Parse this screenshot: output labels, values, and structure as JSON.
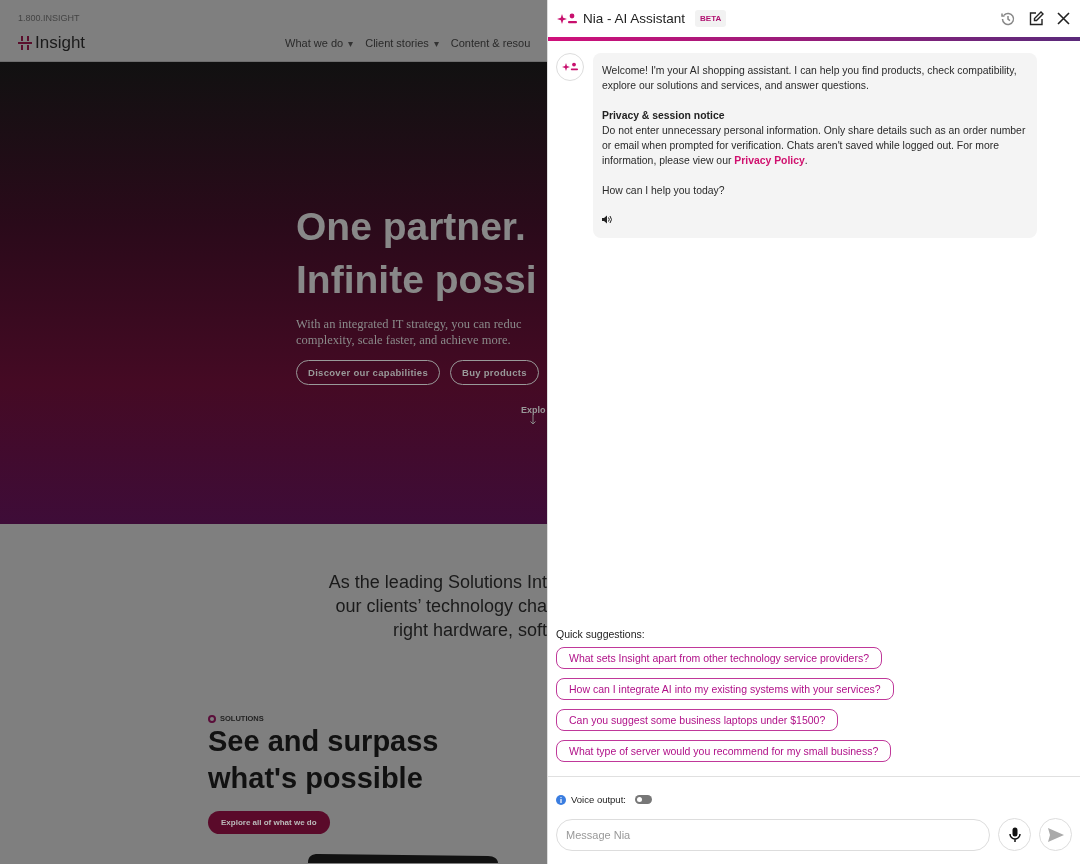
{
  "website": {
    "phone": "1.800.INSIGHT",
    "logo": "Insight",
    "nav": [
      {
        "label": "What we do",
        "caret": "▾"
      },
      {
        "label": "Client stories",
        "caret": "▾"
      },
      {
        "label": "Content & resou"
      }
    ],
    "hero": {
      "title_lines": [
        "One partner.",
        "Infinite possi"
      ],
      "text_lines": [
        "With an integrated IT strategy, you can reduc",
        "complexity, scale faster, and achieve more."
      ],
      "buttons": [
        "Discover our capabilities",
        "Buy products"
      ],
      "scroll_hint": "Explo"
    },
    "intro_lines": [
      "As the leading Solutions Int",
      "our clients’ technology cha",
      "right hardware, soft"
    ],
    "solutions": {
      "eyebrow": "SOLUTIONS",
      "title_lines": [
        "See and surpass",
        "what's possible"
      ],
      "button": "Explore all of what we do"
    }
  },
  "assistant": {
    "title": "Nia - AI Assistant",
    "badge": "BETA",
    "message": {
      "greeting": "Welcome! I'm your AI shopping assistant. I can help you find products, check compatibility, explore our solutions and services, and answer questions.",
      "notice_title": "Privacy & session notice",
      "notice_text": "Do not enter unnecessary personal information. Only share details such as an order number or email when prompted for verification. Chats aren't saved while logged out. For more information, please view our",
      "link": "Privacy Policy",
      "link_after": ".",
      "question": "How can I help you today?"
    },
    "suggestions_label": "Quick suggestions:",
    "suggestions": [
      "What sets Insight apart from other technology service providers?",
      "How can I integrate AI into my existing systems with your services?",
      "Can you suggest some business laptops under $1500?",
      "What type of server would you recommend for my small business?"
    ],
    "voice": {
      "label": "Voice output:",
      "on": false
    },
    "input": {
      "placeholder": "Message Nia"
    }
  }
}
